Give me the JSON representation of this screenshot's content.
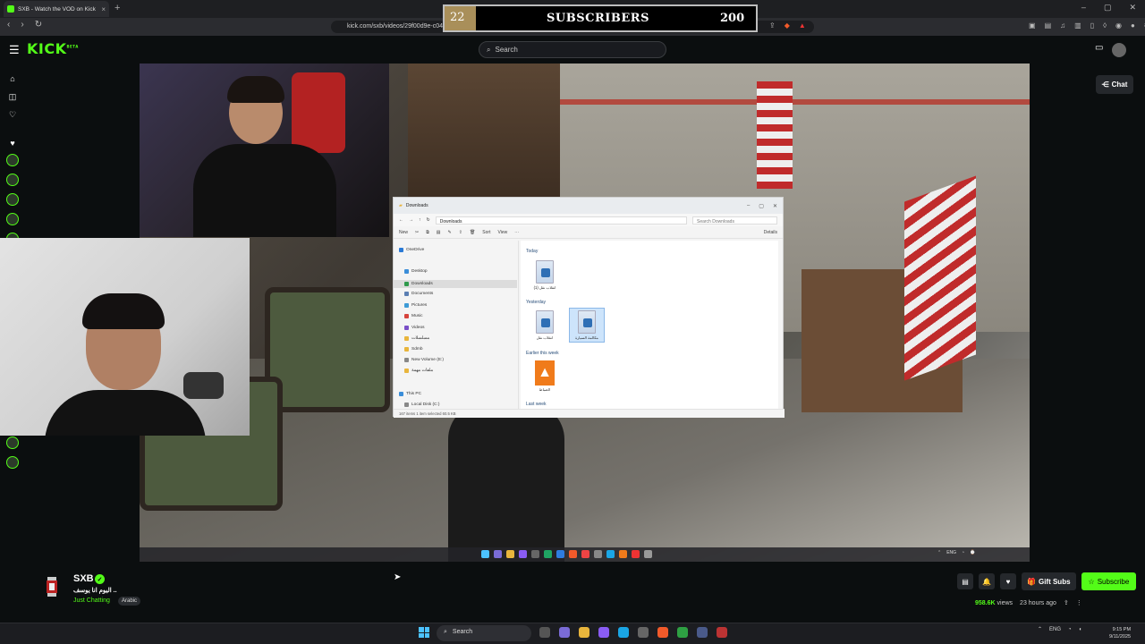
{
  "browser": {
    "tab_title": "SXB - Watch the VOD on Kick",
    "url": "kick.com/sxb/videos/29f00d9e-c04…-04ed0ace06b3"
  },
  "overlay": {
    "count": "22",
    "title": "SUBSCRIBERS",
    "goal": "200"
  },
  "header": {
    "logo": "KICK",
    "logo_badge": "BETA",
    "search_placeholder": "Search"
  },
  "chat_button": {
    "label": "Chat"
  },
  "explorer": {
    "title": "Downloads",
    "path": "Downloads",
    "search_placeholder": "Search Downloads",
    "toolbar": [
      "New",
      "Sort",
      "View",
      "Details"
    ],
    "nav_items": [
      {
        "label": "OneDrive"
      },
      {
        "label": "Desktop"
      },
      {
        "label": "Downloads"
      },
      {
        "label": "Documents"
      },
      {
        "label": "Pictures"
      },
      {
        "label": "Music"
      },
      {
        "label": "Videos"
      },
      {
        "label": "مسلسلات"
      },
      {
        "label": "Sdmb"
      },
      {
        "label": "New Volume (E:)"
      },
      {
        "label": "ملفات مهمة"
      },
      {
        "label": "This PC"
      },
      {
        "label": "Local Disk (C:)"
      }
    ],
    "groups": [
      {
        "label": "Today"
      },
      {
        "label": "Yesterday"
      },
      {
        "label": "Earlier this week"
      },
      {
        "label": "Last week"
      }
    ],
    "files": [
      {
        "label": "انقلاب نقل (1)"
      },
      {
        "label": "انقلاب نقل"
      },
      {
        "label": "مكالمة السيارة"
      },
      {
        "label": "الضباط"
      }
    ],
    "status": "167 items   1 item selected  60.5 KB"
  },
  "channel": {
    "name": "SXB",
    "stream_title": "اليوم انا يوسف ..",
    "category": "Just Chatting",
    "language": "Arabic",
    "views": "958.6K",
    "views_label": "views",
    "time_ago": "23 hours ago",
    "gift_label": "Gift Subs",
    "subscribe_label": "Subscribe"
  },
  "taskbar": {
    "search_placeholder": "Search",
    "lang": "ENG",
    "time": "9:15 PM",
    "date": "9/11/2025"
  },
  "colors": {
    "kick_green": "#53fc18",
    "background": "#0b0e0f",
    "overlay_gold": "#a98f5a"
  }
}
